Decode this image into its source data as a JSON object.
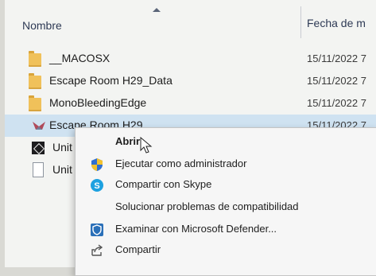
{
  "header": {
    "col_name": "Nombre",
    "col_date": "Fecha de m"
  },
  "files": [
    {
      "name": "__MACOSX",
      "date": "15/11/2022 7",
      "icon": "folder-icon"
    },
    {
      "name": "Escape Room H29_Data",
      "date": "15/11/2022 7",
      "icon": "folder-icon"
    },
    {
      "name": "MonoBleedingEdge",
      "date": "15/11/2022 7",
      "icon": "folder-icon"
    },
    {
      "name": "Escape Room H29",
      "date": "15/11/2022 7",
      "icon": "app-icon",
      "selected": true
    },
    {
      "name": "Unit",
      "date": "",
      "icon": "unity-icon"
    },
    {
      "name": "Unit",
      "date": "",
      "icon": "doc-icon"
    }
  ],
  "context_menu": {
    "items": [
      {
        "label": "Abrir",
        "icon": "",
        "bold": true
      },
      {
        "label": "Ejecutar como administrador",
        "icon": "uac-shield-icon"
      },
      {
        "label": "Compartir con Skype",
        "icon": "skype-icon"
      },
      {
        "label": "Solucionar problemas de compatibilidad",
        "icon": ""
      },
      {
        "label": "Examinar con Microsoft Defender...",
        "icon": "defender-icon"
      },
      {
        "label": "Compartir",
        "icon": "share-icon"
      }
    ]
  },
  "colors": {
    "selection": "#cfe2f1",
    "folder": "#f0c15a",
    "skype": "#1da1e0",
    "shield_blue": "#2f6fd1",
    "shield_yellow": "#f2c12e"
  }
}
